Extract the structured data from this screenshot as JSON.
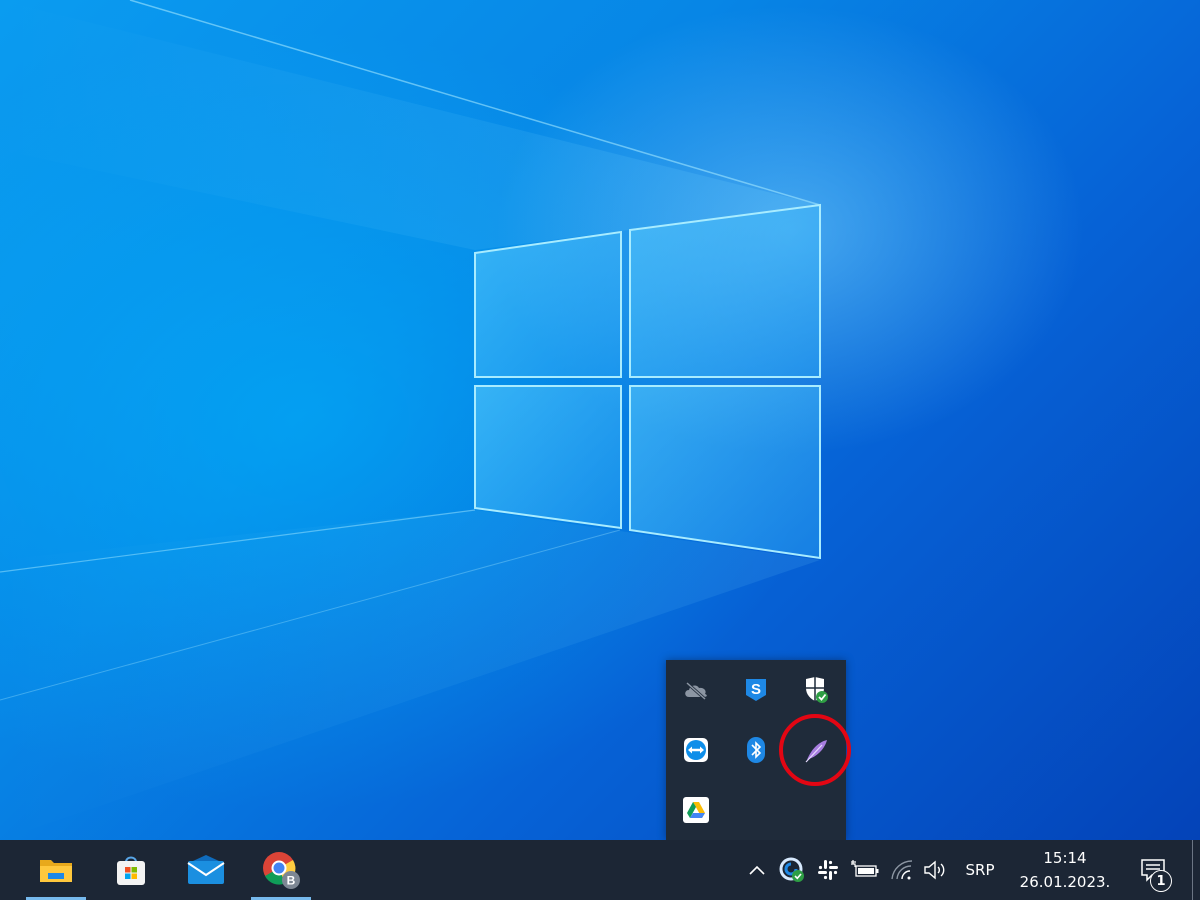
{
  "desktop": {
    "wallpaper": "windows-10-hero-light-logo"
  },
  "tray_flyout": {
    "icons": [
      {
        "name": "onedrive-offline-icon"
      },
      {
        "name": "sophos-icon",
        "glyph": "S"
      },
      {
        "name": "windows-security-icon"
      },
      {
        "name": "teamviewer-icon"
      },
      {
        "name": "bluetooth-icon"
      },
      {
        "name": "feather-app-icon",
        "highlighted": true
      },
      {
        "name": "google-drive-icon"
      }
    ],
    "highlight_color": "#e30613"
  },
  "taskbar": {
    "apps": [
      {
        "name": "file-explorer-icon",
        "active": true
      },
      {
        "name": "microsoft-store-icon",
        "active": false
      },
      {
        "name": "mail-icon",
        "active": false
      },
      {
        "name": "chrome-icon",
        "active": true,
        "profile_badge": "B"
      }
    ],
    "tray": {
      "overflow_chevron": "^",
      "language": "SRP",
      "time": "15:14",
      "date": "26.01.2023.",
      "notification_count": "1"
    },
    "accent": "#76b9ed"
  }
}
